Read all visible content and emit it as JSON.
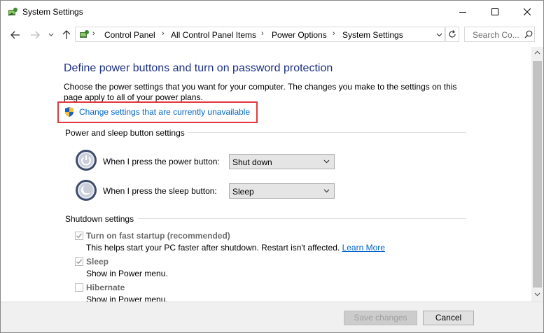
{
  "window": {
    "title": "System Settings"
  },
  "address": {
    "crumbs": [
      "Control Panel",
      "All Control Panel Items",
      "Power Options",
      "System Settings"
    ],
    "search_placeholder": "Search Co..."
  },
  "page": {
    "heading": "Define power buttons and turn on password protection",
    "description": "Choose the power settings that you want for your computer. The changes you make to the settings on this page apply to all of your power plans.",
    "change_link": "Change settings that are currently unavailable"
  },
  "power_section": {
    "title": "Power and sleep button settings",
    "power_label": "When I press the power button:",
    "power_value": "Shut down",
    "sleep_label": "When I press the sleep button:",
    "sleep_value": "Sleep"
  },
  "shutdown_section": {
    "title": "Shutdown settings",
    "fast_startup_label": "Turn on fast startup (recommended)",
    "fast_startup_desc": "This helps start your PC faster after shutdown. Restart isn't affected.",
    "learn_more": "Learn More",
    "sleep_label": "Sleep",
    "sleep_desc": "Show in Power menu.",
    "hibernate_label": "Hibernate",
    "hibernate_desc": "Show in Power menu."
  },
  "footer": {
    "save_label": "Save changes",
    "cancel_label": "Cancel"
  },
  "colors": {
    "heading": "#1e3287",
    "link": "#0066cc",
    "highlight": "#e2383d"
  }
}
